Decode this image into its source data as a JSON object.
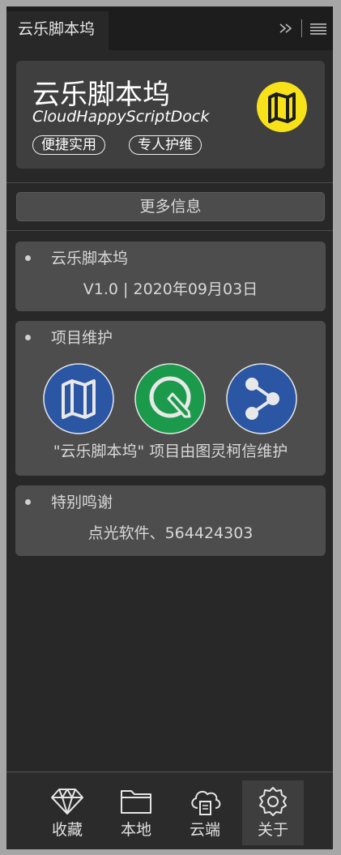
{
  "tab": {
    "title": "云乐脚本坞"
  },
  "header": {
    "title": "云乐脚本坞",
    "subtitle": "CloudHappyScriptDock",
    "tags": [
      "便捷实用",
      "专人护维"
    ]
  },
  "more_button": "更多信息",
  "cards": {
    "version": {
      "title": "云乐脚本坞",
      "line": "V1.0 | 2020年09月03日"
    },
    "maintain": {
      "title": "项目维护",
      "line": "\"云乐脚本坞\" 项目由图灵柯信维护"
    },
    "thanks": {
      "title": "特别鸣谢",
      "line": "点光软件、564424303"
    }
  },
  "nav": [
    {
      "label": "收藏",
      "icon": "diamond-icon"
    },
    {
      "label": "本地",
      "icon": "folder-icon"
    },
    {
      "label": "云端",
      "icon": "cloud-icon"
    },
    {
      "label": "关于",
      "icon": "badge-icon"
    }
  ],
  "colors": {
    "logo_yellow": "#f7e21a",
    "blue": "#2b56a3",
    "green": "#1b9a4b"
  }
}
